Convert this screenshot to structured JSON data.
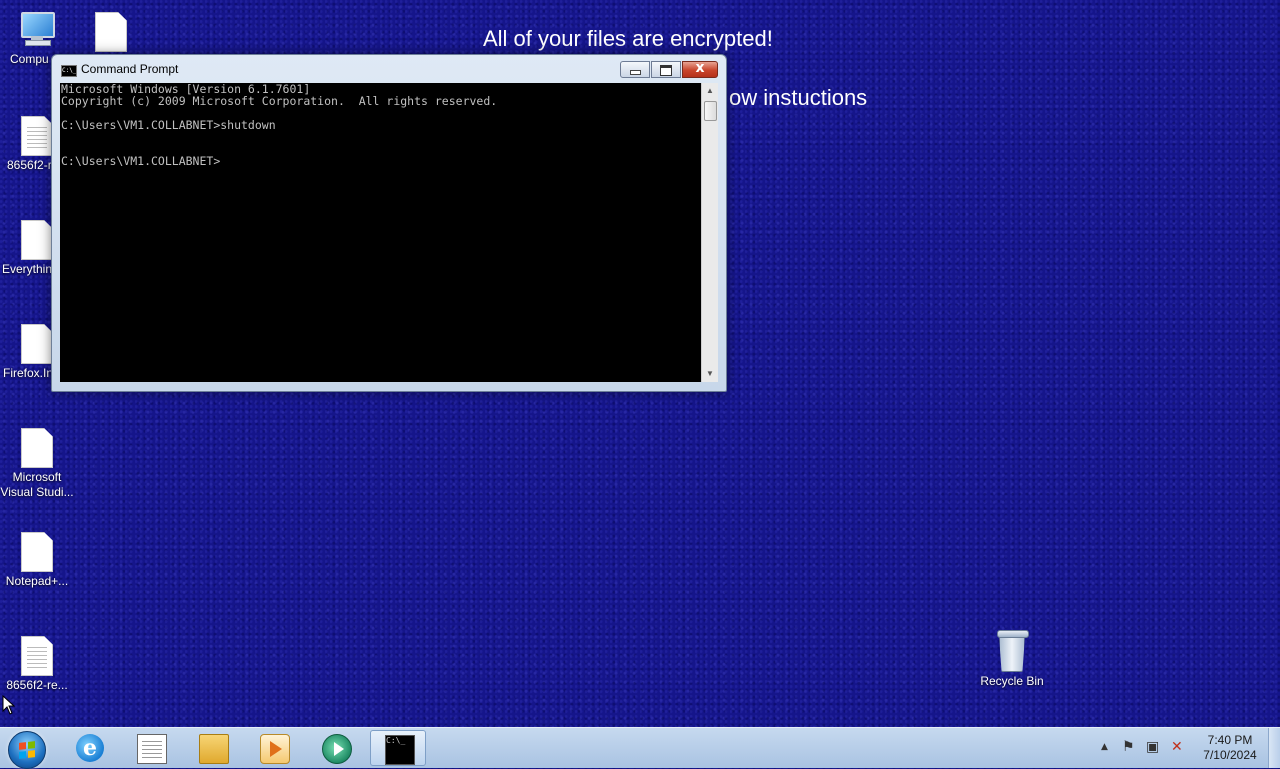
{
  "wallpaper": {
    "line1": "All of your files are encrypted!",
    "line2_partial": "ow instuctions"
  },
  "desktop_icons": [
    {
      "label": "Compu"
    },
    {
      "label": ""
    },
    {
      "label": "8656f2-r"
    },
    {
      "label": "Everythin"
    },
    {
      "label": "Firefox.In"
    },
    {
      "label_line1": "Microsoft",
      "label_line2": "Visual Studi..."
    },
    {
      "label": "Notepad+..."
    },
    {
      "label": "8656f2-re..."
    }
  ],
  "recycle_bin": {
    "label": "Recycle Bin"
  },
  "cmd": {
    "title": "Command Prompt",
    "icon_text": "C:\\_",
    "close_glyph": "x",
    "lines": [
      "Microsoft Windows [Version 6.1.7601]",
      "Copyright (c) 2009 Microsoft Corporation.  All rights reserved.",
      "",
      "C:\\Users\\VM1.COLLABNET>shutdown",
      "",
      "",
      "C:\\Users\\VM1.COLLABNET>"
    ]
  },
  "taskbar": {
    "items": [
      {
        "name": "internet-explorer",
        "glyph": "e"
      },
      {
        "name": "notepad"
      },
      {
        "name": "windows-explorer"
      },
      {
        "name": "media-player"
      },
      {
        "name": "circular-app"
      },
      {
        "name": "command-prompt",
        "glyph": "C:\\_",
        "active": true
      }
    ],
    "tray": {
      "up_arrow": "▲",
      "flag": "⚑",
      "network": "▣",
      "volume": "✕"
    },
    "clock_time": "7:40 PM",
    "clock_date": "7/10/2024"
  },
  "colors": {
    "desktop_background": "#15158a",
    "taskbar": "#b8cfe9",
    "console_background": "#000000",
    "console_text": "#c0c0c0"
  }
}
